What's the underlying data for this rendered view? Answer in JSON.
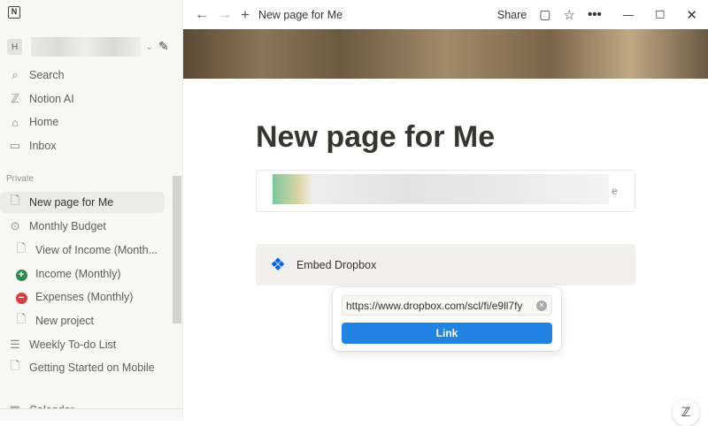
{
  "sidebar": {
    "workspace_initial": "H",
    "nav": [
      {
        "label": "Search",
        "icon": "search-icon"
      },
      {
        "label": "Notion AI",
        "icon": "notion-ai-icon"
      },
      {
        "label": "Home",
        "icon": "home-icon"
      },
      {
        "label": "Inbox",
        "icon": "inbox-icon"
      }
    ],
    "section": "Private",
    "pages": [
      {
        "label": "New page for Me",
        "icon": "page-icon",
        "active": true
      },
      {
        "label": "Monthly Budget",
        "icon": "budget-icon"
      },
      {
        "label": "View of Income (Month...",
        "icon": "linked-page-icon",
        "sub": true
      },
      {
        "label": "Income (Monthly)",
        "icon": "plus-circle-icon",
        "sub": true,
        "color": "#2f8a4f"
      },
      {
        "label": "Expenses (Monthly)",
        "icon": "minus-circle-icon",
        "sub": true,
        "color": "#d93f3f"
      },
      {
        "label": "New project",
        "icon": "page-icon",
        "sub": true
      },
      {
        "label": "Weekly To-do List",
        "icon": "list-icon"
      },
      {
        "label": "Getting Started on Mobile",
        "icon": "page-icon"
      },
      {
        "label": "Calendar",
        "icon": "calendar-icon"
      }
    ]
  },
  "topbar": {
    "breadcrumb": "New page for Me",
    "share": "Share"
  },
  "page": {
    "title": "New page for Me",
    "embed_label": "Embed Dropbox",
    "partial_text": "e"
  },
  "popup": {
    "url_value": "https://www.dropbox.com/scl/fi/e9ll7fy",
    "link_button": "Link"
  },
  "colors": {
    "accent": "#2383e2",
    "dropbox": "#0061fe"
  }
}
